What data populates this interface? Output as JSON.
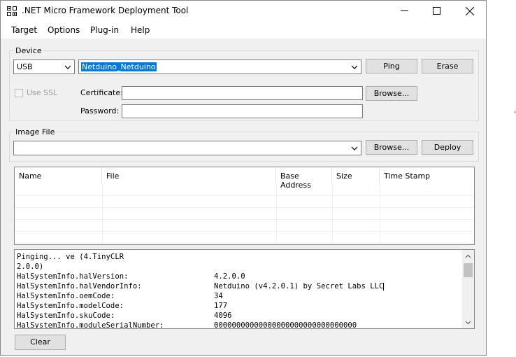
{
  "window": {
    "title": ".NET Micro Framework Deployment Tool"
  },
  "menu": [
    "Target",
    "Options",
    "Plug-in",
    "Help"
  ],
  "device": {
    "group_label": "Device",
    "transport": "USB",
    "device_name": "Netduino_Netduino",
    "ping_label": "Ping",
    "erase_label": "Erase",
    "use_ssl_label": "Use SSL",
    "certificate_label": "Certificate:",
    "password_label": "Password:",
    "browse_label": "Browse..."
  },
  "image_file": {
    "group_label": "Image File",
    "browse_label": "Browse...",
    "deploy_label": "Deploy"
  },
  "list": {
    "columns": [
      "Name",
      "File",
      "Base Address",
      "Size",
      "Time Stamp"
    ]
  },
  "output": {
    "lines": [
      {
        "key": "Pinging... ve (4.TinyCLR",
        "value": ""
      },
      {
        "key": "2.0.0)",
        "value": ""
      },
      {
        "key": "HalSystemInfo.halVersion:",
        "value": "4.2.0.0"
      },
      {
        "key": "HalSystemInfo.halVendorInfo:",
        "value": "Netduino (v4.2.0.1) by Secret Labs LLC"
      },
      {
        "key": "HalSystemInfo.oemCode:",
        "value": "34"
      },
      {
        "key": "HalSystemInfo.modelCode:",
        "value": "177"
      },
      {
        "key": "HalSystemInfo.skuCode:",
        "value": "4096"
      },
      {
        "key": "HalSystemInfo.moduleSerialNumber:",
        "value": "00000000000000000000000000000000"
      }
    ]
  },
  "clear_label": "Clear",
  "stray_mark": "'"
}
